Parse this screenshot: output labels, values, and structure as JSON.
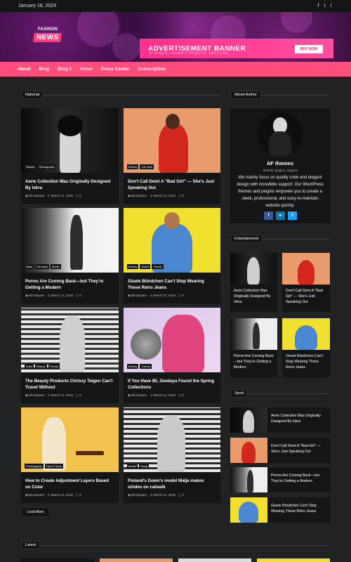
{
  "topbar": {
    "date": "January 18, 2024",
    "social": [
      "f",
      "t",
      "i"
    ]
  },
  "banner": {
    "logo_top": "FASHION",
    "logo_main": "NEWS",
    "ad_heading": "ADVERTISEMENT BANNER",
    "ad_sub": "BANNER ADVERTISEMENT SECTION",
    "ad_button": "BUY NOW"
  },
  "nav": {
    "items": [
      "About",
      "Blog",
      "Blog 2",
      "Home",
      "Press Center",
      "Subscription"
    ]
  },
  "national": {
    "title": "National",
    "cards": [
      {
        "tags": [
          "Beauty",
          "Photography"
        ],
        "title": "Aerie Collection Was Originally Designed By Iskra",
        "author": "Blockspare",
        "date": "March 12, 2018",
        "comments": "0"
      },
      {
        "tags": [
          "Beauty",
          "Life style"
        ],
        "title": "Don't Call Demi A \"Bad Girl\" — She's Just Speaking Out",
        "author": "Blockspare",
        "date": "March 12, 2018",
        "comments": "0"
      },
      {
        "tags": [
          "Artist",
          "Life style",
          "Model"
        ],
        "title": "Perms Are Coming Back—but They're Getting a Modern",
        "author": "Blockspare",
        "date": "March 12, 2018",
        "comments": "0"
      },
      {
        "tags": [
          "Beauty",
          "Model",
          "Trends"
        ],
        "title": "Gisele Bündchen Can't Stop Wearing These Retro Jeans",
        "author": "Blockspare",
        "date": "March 12, 2018",
        "comments": "0"
      },
      {
        "tags": [
          "Artist",
          "Beauty",
          "Trends"
        ],
        "title": "The Beauty Products Chrissy Teigen Can't Travel Without",
        "author": "Blockspare",
        "date": "March 12, 2018",
        "comments": "0"
      },
      {
        "tags": [
          "Beauty",
          "Trends"
        ],
        "title": "If You Have $5, Zendaya Found the Spring Collections",
        "author": "Blockspare",
        "date": "March 12, 2018",
        "comments": "0"
      },
      {
        "tags": [
          "Photography",
          "Tips & Tricks"
        ],
        "title": "How to Create Adjustment Layers Based on Color",
        "author": "Blockspare",
        "date": "March 12, 2018",
        "comments": "0"
      },
      {
        "tags": [
          "Model",
          "Swag"
        ],
        "title": "Finland's Down's model Malja makes strides on catwalk",
        "author": "Blockspare",
        "date": "March 12, 2018",
        "comments": "0"
      }
    ],
    "load_more": "Load More"
  },
  "about": {
    "title": "About Author",
    "name": "AF themes",
    "tagline": "themes, plugins, support",
    "description": "We mainly focus on quality code and elegant design with incredible support. Our WordPress themes and plugins empower you to create a sleek, professional, and easy-to-maintain website quickly.",
    "buttons": [
      "f",
      "in",
      "t"
    ]
  },
  "entertainment": {
    "title": "Entertainment",
    "items": [
      "Aerie Collection Was Originally Designed By Iskra",
      "Don't Call Demi A \"Bad Girl\" — She's Just Speaking Out",
      "Perms Are Coming Back—but They're Getting a Modern",
      "Gisele Bündchen Can't Stop Wearing These Retro Jeans"
    ]
  },
  "sport": {
    "title": "Sport",
    "items": [
      "Aerie Collection Was Originally Designed By Iskra",
      "Don't Call Demi A \"Bad Girl\" — She's Just Speaking Out",
      "Perms Are Coming Back—but They're Getting a Modern",
      "Gisele Bündchen Can't Stop Wearing These Retro Jeans"
    ]
  },
  "latest": {
    "title": "Latest"
  },
  "colors": {
    "accent": "#ff4d7e",
    "background": "#202223",
    "card": "#141516"
  }
}
